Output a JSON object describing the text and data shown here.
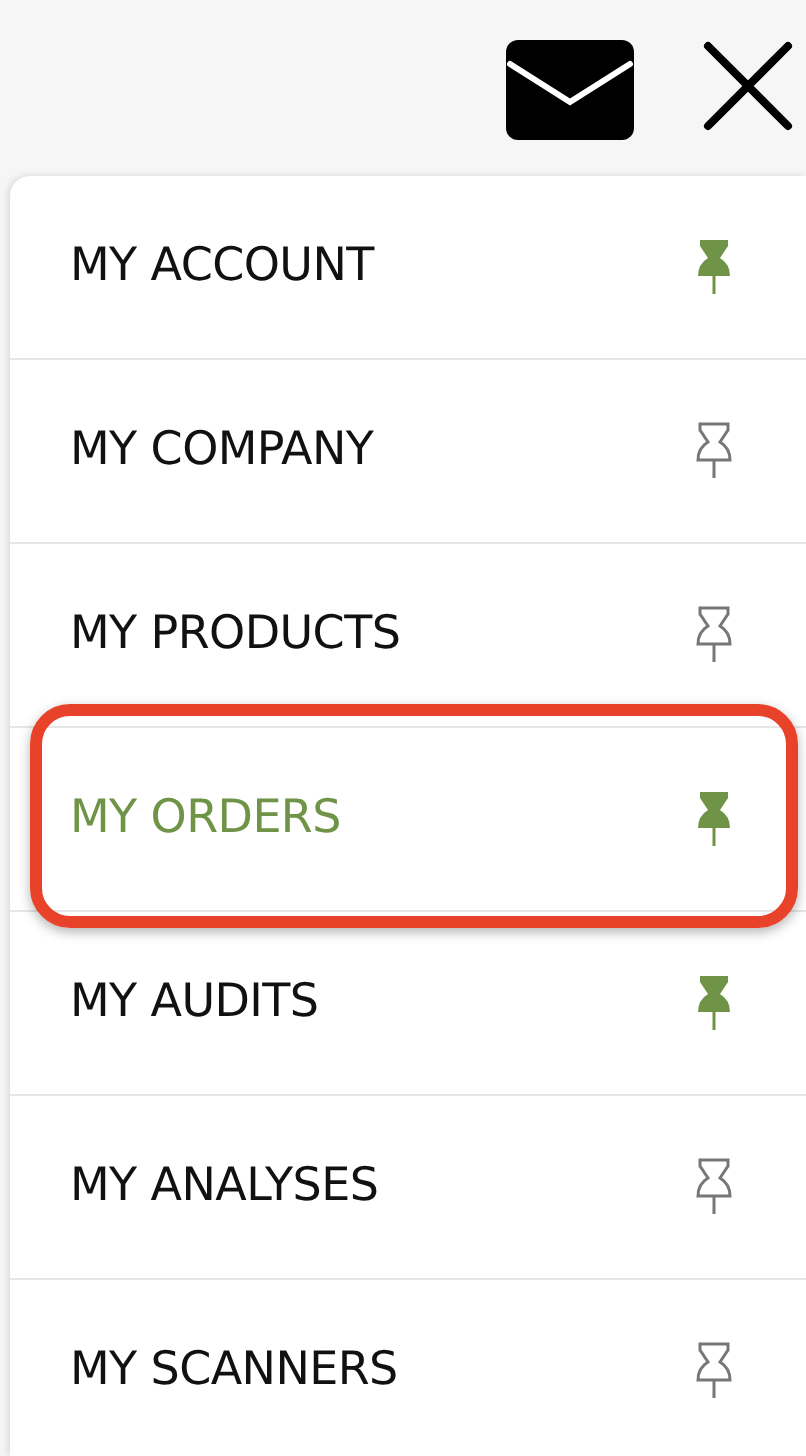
{
  "menu": {
    "items": [
      {
        "label": "MY ACCOUNT",
        "selected": false,
        "pinned": true,
        "highlighted": false
      },
      {
        "label": "MY COMPANY",
        "selected": false,
        "pinned": false,
        "highlighted": false
      },
      {
        "label": "MY PRODUCTS",
        "selected": false,
        "pinned": false,
        "highlighted": false
      },
      {
        "label": "MY ORDERS",
        "selected": true,
        "pinned": true,
        "highlighted": true
      },
      {
        "label": "MY AUDITS",
        "selected": false,
        "pinned": true,
        "highlighted": false
      },
      {
        "label": "MY ANALYSES",
        "selected": false,
        "pinned": false,
        "highlighted": false
      },
      {
        "label": "MY SCANNERS",
        "selected": false,
        "pinned": false,
        "highlighted": false
      }
    ]
  }
}
